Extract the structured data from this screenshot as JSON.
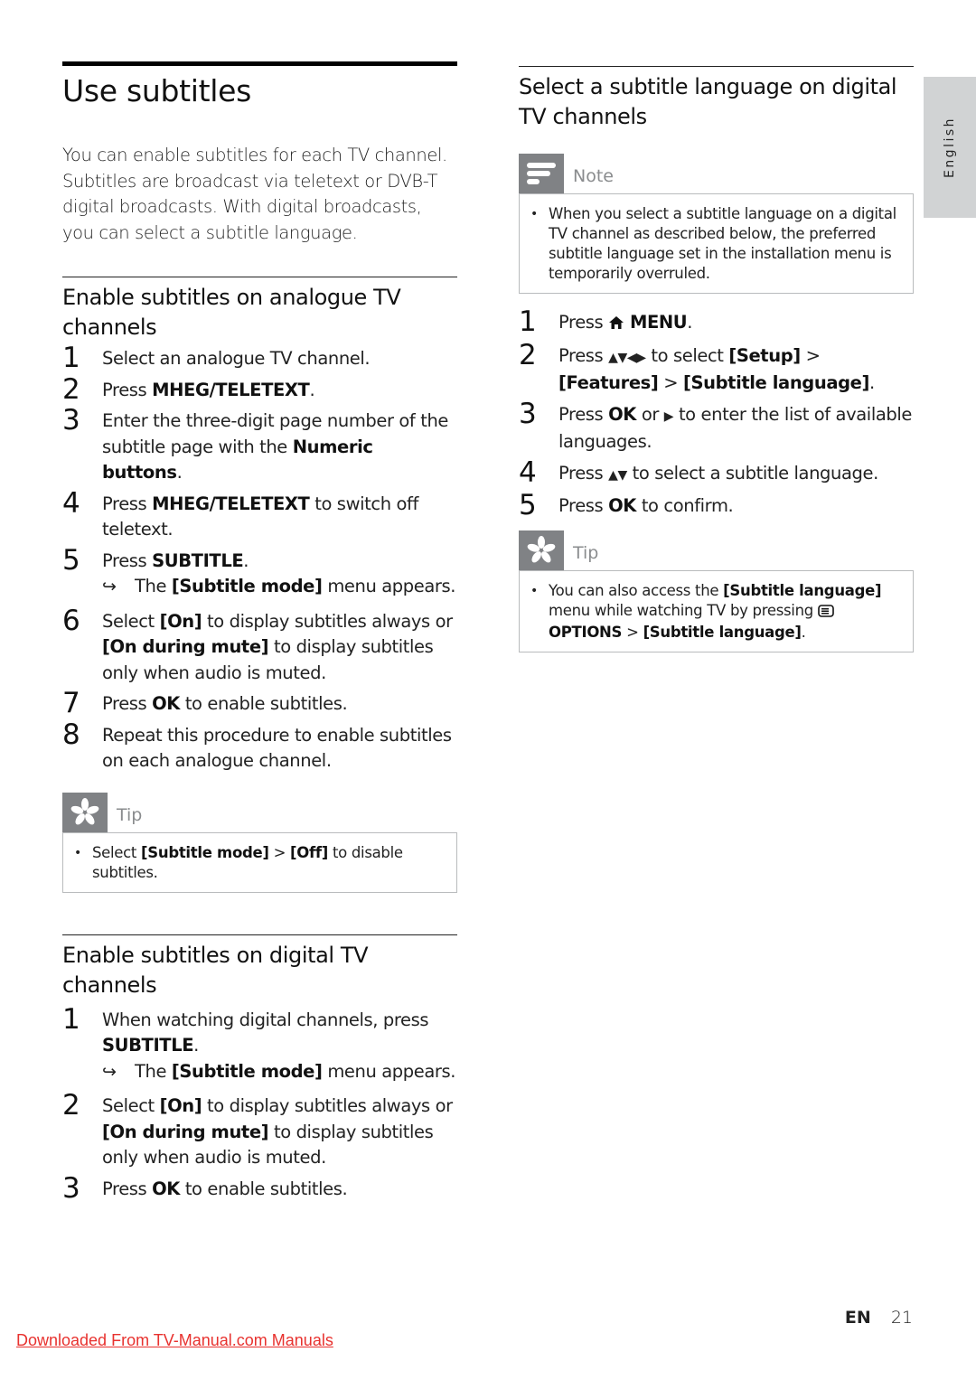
{
  "page": {
    "title": "Use subtitles",
    "intro": "You can enable subtitles for each TV channel. Subtitles are broadcast via teletext or DVB-T digital broadcasts. With digital broadcasts, you can select a subtitle language.",
    "language_tab": "English",
    "footer": {
      "lang_code": "EN",
      "page_number": "21"
    },
    "watermark_link": "Downloaded From TV-Manual.com Manuals"
  },
  "analogue": {
    "heading": "Enable subtitles on analogue TV channels",
    "steps": [
      {
        "num": "1",
        "parts": [
          "Select an analogue TV channel."
        ]
      },
      {
        "num": "2",
        "pre": "Press ",
        "bold": "MHEG/TELETEXT",
        "post": "."
      },
      {
        "num": "3",
        "pre": "Enter the three-digit page number of the subtitle page with the ",
        "bold": "Numeric buttons",
        "post": "."
      },
      {
        "num": "4",
        "pre": "Press ",
        "bold": "MHEG/TELETEXT",
        "post": " to switch off teletext."
      },
      {
        "num": "5",
        "pre": "Press ",
        "bold": "SUBTITLE",
        "post": ".",
        "result_pre": "The ",
        "result_bold": "[Subtitle mode]",
        "result_post": " menu appears."
      },
      {
        "num": "6",
        "pre": "Select ",
        "bold": "[On]",
        "mid": " to display subtitles always or ",
        "bold2": "[On during mute]",
        "post": " to display subtitles only when audio is muted."
      },
      {
        "num": "7",
        "pre": "Press ",
        "bold": "OK",
        "post": " to enable subtitles."
      },
      {
        "num": "8",
        "text": "Repeat this procedure to enable subtitles on each analogue channel."
      }
    ],
    "tip": {
      "label": "Tip",
      "pre": "Select ",
      "bold1": "[Subtitle mode]",
      "sep": " > ",
      "bold2": "[Off]",
      "post": " to disable subtitles."
    }
  },
  "digital": {
    "heading": "Enable subtitles on digital TV channels",
    "steps": [
      {
        "num": "1",
        "pre": "When watching digital channels, press ",
        "bold": "SUBTITLE",
        "post": ".",
        "result_pre": "The ",
        "result_bold": "[Subtitle mode]",
        "result_post": " menu appears."
      },
      {
        "num": "2",
        "pre": "Select ",
        "bold": "[On]",
        "mid": " to display subtitles always or ",
        "bold2": "[On during mute]",
        "post": " to display subtitles only when audio is muted."
      },
      {
        "num": "3",
        "pre": "Press ",
        "bold": "OK",
        "post": " to enable subtitles."
      }
    ]
  },
  "language": {
    "heading": "Select a subtitle language on digital TV channels",
    "note": {
      "label": "Note",
      "text": "When you select a subtitle language on a digital TV channel as described below, the preferred subtitle language set in the installation menu is temporarily overruled."
    },
    "steps": [
      {
        "num": "1",
        "pre": "Press ",
        "icon": "home-icon",
        "bold": "MENU",
        "post": "."
      },
      {
        "num": "2",
        "pre": "Press ",
        "arrows": "▲▼◀▶",
        "mid": " to select ",
        "bold": "[Setup]",
        "sep1": " > ",
        "bold2": "[Features]",
        "sep2": " > ",
        "bold3": "[Subtitle language]",
        "post": "."
      },
      {
        "num": "3",
        "pre": "Press ",
        "bold": "OK",
        "mid": " or ",
        "arrows": "▶",
        "post": " to enter the list of available languages."
      },
      {
        "num": "4",
        "pre": "Press ",
        "arrows": "▲▼",
        "post": " to select a subtitle language."
      },
      {
        "num": "5",
        "pre": "Press ",
        "bold": "OK",
        "post": " to confirm."
      }
    ],
    "tip": {
      "label": "Tip",
      "pre": "You can also access the ",
      "bold1": "[Subtitle language]",
      "mid": " menu while watching TV by pressing ",
      "icon": "options-icon",
      "bold2": "OPTIONS",
      "sep": " > ",
      "bold3": "[Subtitle language]",
      "post": "."
    }
  }
}
